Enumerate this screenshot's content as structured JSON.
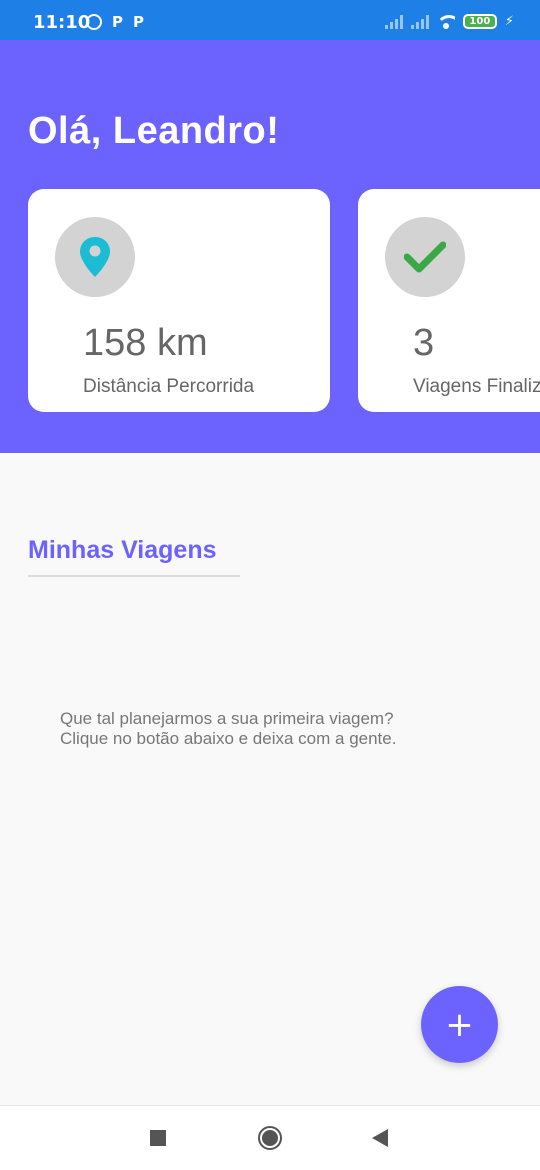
{
  "status_bar": {
    "time": "11:10",
    "left_icons": [
      "alarm-icon",
      "P",
      "P"
    ],
    "battery": "100"
  },
  "header": {
    "greeting": "Olá, Leandro!"
  },
  "cards": [
    {
      "icon": "location-pin-icon",
      "value": "158 km",
      "label": "Distância Percorrida"
    },
    {
      "icon": "check-icon",
      "value": "3",
      "label": "Viagens Finalizadas"
    }
  ],
  "section": {
    "title": "Minhas Viagens"
  },
  "empty_state": {
    "line1": "Que tal planejarmos a sua primeira viagem?",
    "line2": "Clique no botão abaixo e deixa com a gente."
  },
  "fab": {
    "label": "+"
  },
  "colors": {
    "primary": "#6c63ff",
    "status_bar": "#1e7fe6",
    "pin": "#1bbcd4",
    "check": "#3aa845"
  }
}
